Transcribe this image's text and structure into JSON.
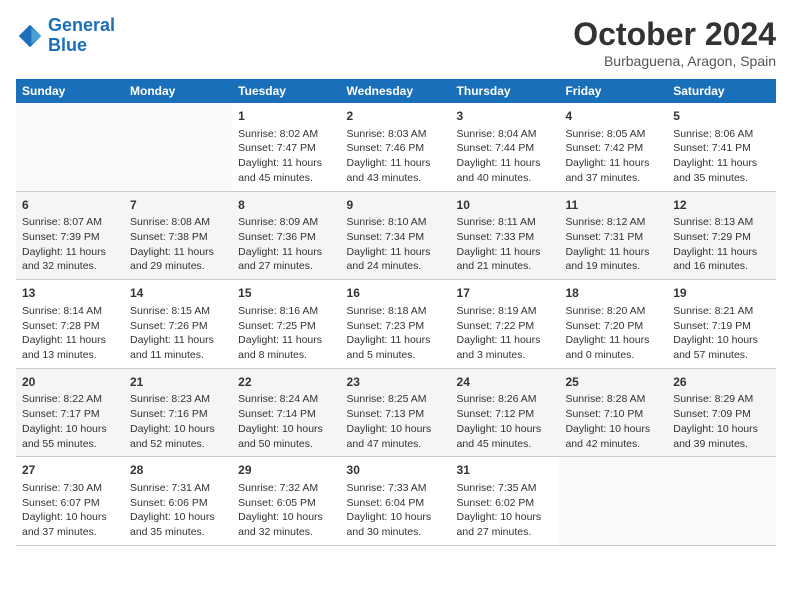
{
  "header": {
    "logo_line1": "General",
    "logo_line2": "Blue",
    "month": "October 2024",
    "location": "Burbaguena, Aragon, Spain"
  },
  "weekdays": [
    "Sunday",
    "Monday",
    "Tuesday",
    "Wednesday",
    "Thursday",
    "Friday",
    "Saturday"
  ],
  "weeks": [
    [
      {
        "day": "",
        "sunrise": "",
        "sunset": "",
        "daylight": ""
      },
      {
        "day": "",
        "sunrise": "",
        "sunset": "",
        "daylight": ""
      },
      {
        "day": "1",
        "sunrise": "Sunrise: 8:02 AM",
        "sunset": "Sunset: 7:47 PM",
        "daylight": "Daylight: 11 hours and 45 minutes."
      },
      {
        "day": "2",
        "sunrise": "Sunrise: 8:03 AM",
        "sunset": "Sunset: 7:46 PM",
        "daylight": "Daylight: 11 hours and 43 minutes."
      },
      {
        "day": "3",
        "sunrise": "Sunrise: 8:04 AM",
        "sunset": "Sunset: 7:44 PM",
        "daylight": "Daylight: 11 hours and 40 minutes."
      },
      {
        "day": "4",
        "sunrise": "Sunrise: 8:05 AM",
        "sunset": "Sunset: 7:42 PM",
        "daylight": "Daylight: 11 hours and 37 minutes."
      },
      {
        "day": "5",
        "sunrise": "Sunrise: 8:06 AM",
        "sunset": "Sunset: 7:41 PM",
        "daylight": "Daylight: 11 hours and 35 minutes."
      }
    ],
    [
      {
        "day": "6",
        "sunrise": "Sunrise: 8:07 AM",
        "sunset": "Sunset: 7:39 PM",
        "daylight": "Daylight: 11 hours and 32 minutes."
      },
      {
        "day": "7",
        "sunrise": "Sunrise: 8:08 AM",
        "sunset": "Sunset: 7:38 PM",
        "daylight": "Daylight: 11 hours and 29 minutes."
      },
      {
        "day": "8",
        "sunrise": "Sunrise: 8:09 AM",
        "sunset": "Sunset: 7:36 PM",
        "daylight": "Daylight: 11 hours and 27 minutes."
      },
      {
        "day": "9",
        "sunrise": "Sunrise: 8:10 AM",
        "sunset": "Sunset: 7:34 PM",
        "daylight": "Daylight: 11 hours and 24 minutes."
      },
      {
        "day": "10",
        "sunrise": "Sunrise: 8:11 AM",
        "sunset": "Sunset: 7:33 PM",
        "daylight": "Daylight: 11 hours and 21 minutes."
      },
      {
        "day": "11",
        "sunrise": "Sunrise: 8:12 AM",
        "sunset": "Sunset: 7:31 PM",
        "daylight": "Daylight: 11 hours and 19 minutes."
      },
      {
        "day": "12",
        "sunrise": "Sunrise: 8:13 AM",
        "sunset": "Sunset: 7:29 PM",
        "daylight": "Daylight: 11 hours and 16 minutes."
      }
    ],
    [
      {
        "day": "13",
        "sunrise": "Sunrise: 8:14 AM",
        "sunset": "Sunset: 7:28 PM",
        "daylight": "Daylight: 11 hours and 13 minutes."
      },
      {
        "day": "14",
        "sunrise": "Sunrise: 8:15 AM",
        "sunset": "Sunset: 7:26 PM",
        "daylight": "Daylight: 11 hours and 11 minutes."
      },
      {
        "day": "15",
        "sunrise": "Sunrise: 8:16 AM",
        "sunset": "Sunset: 7:25 PM",
        "daylight": "Daylight: 11 hours and 8 minutes."
      },
      {
        "day": "16",
        "sunrise": "Sunrise: 8:18 AM",
        "sunset": "Sunset: 7:23 PM",
        "daylight": "Daylight: 11 hours and 5 minutes."
      },
      {
        "day": "17",
        "sunrise": "Sunrise: 8:19 AM",
        "sunset": "Sunset: 7:22 PM",
        "daylight": "Daylight: 11 hours and 3 minutes."
      },
      {
        "day": "18",
        "sunrise": "Sunrise: 8:20 AM",
        "sunset": "Sunset: 7:20 PM",
        "daylight": "Daylight: 11 hours and 0 minutes."
      },
      {
        "day": "19",
        "sunrise": "Sunrise: 8:21 AM",
        "sunset": "Sunset: 7:19 PM",
        "daylight": "Daylight: 10 hours and 57 minutes."
      }
    ],
    [
      {
        "day": "20",
        "sunrise": "Sunrise: 8:22 AM",
        "sunset": "Sunset: 7:17 PM",
        "daylight": "Daylight: 10 hours and 55 minutes."
      },
      {
        "day": "21",
        "sunrise": "Sunrise: 8:23 AM",
        "sunset": "Sunset: 7:16 PM",
        "daylight": "Daylight: 10 hours and 52 minutes."
      },
      {
        "day": "22",
        "sunrise": "Sunrise: 8:24 AM",
        "sunset": "Sunset: 7:14 PM",
        "daylight": "Daylight: 10 hours and 50 minutes."
      },
      {
        "day": "23",
        "sunrise": "Sunrise: 8:25 AM",
        "sunset": "Sunset: 7:13 PM",
        "daylight": "Daylight: 10 hours and 47 minutes."
      },
      {
        "day": "24",
        "sunrise": "Sunrise: 8:26 AM",
        "sunset": "Sunset: 7:12 PM",
        "daylight": "Daylight: 10 hours and 45 minutes."
      },
      {
        "day": "25",
        "sunrise": "Sunrise: 8:28 AM",
        "sunset": "Sunset: 7:10 PM",
        "daylight": "Daylight: 10 hours and 42 minutes."
      },
      {
        "day": "26",
        "sunrise": "Sunrise: 8:29 AM",
        "sunset": "Sunset: 7:09 PM",
        "daylight": "Daylight: 10 hours and 39 minutes."
      }
    ],
    [
      {
        "day": "27",
        "sunrise": "Sunrise: 7:30 AM",
        "sunset": "Sunset: 6:07 PM",
        "daylight": "Daylight: 10 hours and 37 minutes."
      },
      {
        "day": "28",
        "sunrise": "Sunrise: 7:31 AM",
        "sunset": "Sunset: 6:06 PM",
        "daylight": "Daylight: 10 hours and 35 minutes."
      },
      {
        "day": "29",
        "sunrise": "Sunrise: 7:32 AM",
        "sunset": "Sunset: 6:05 PM",
        "daylight": "Daylight: 10 hours and 32 minutes."
      },
      {
        "day": "30",
        "sunrise": "Sunrise: 7:33 AM",
        "sunset": "Sunset: 6:04 PM",
        "daylight": "Daylight: 10 hours and 30 minutes."
      },
      {
        "day": "31",
        "sunrise": "Sunrise: 7:35 AM",
        "sunset": "Sunset: 6:02 PM",
        "daylight": "Daylight: 10 hours and 27 minutes."
      },
      {
        "day": "",
        "sunrise": "",
        "sunset": "",
        "daylight": ""
      },
      {
        "day": "",
        "sunrise": "",
        "sunset": "",
        "daylight": ""
      }
    ]
  ]
}
